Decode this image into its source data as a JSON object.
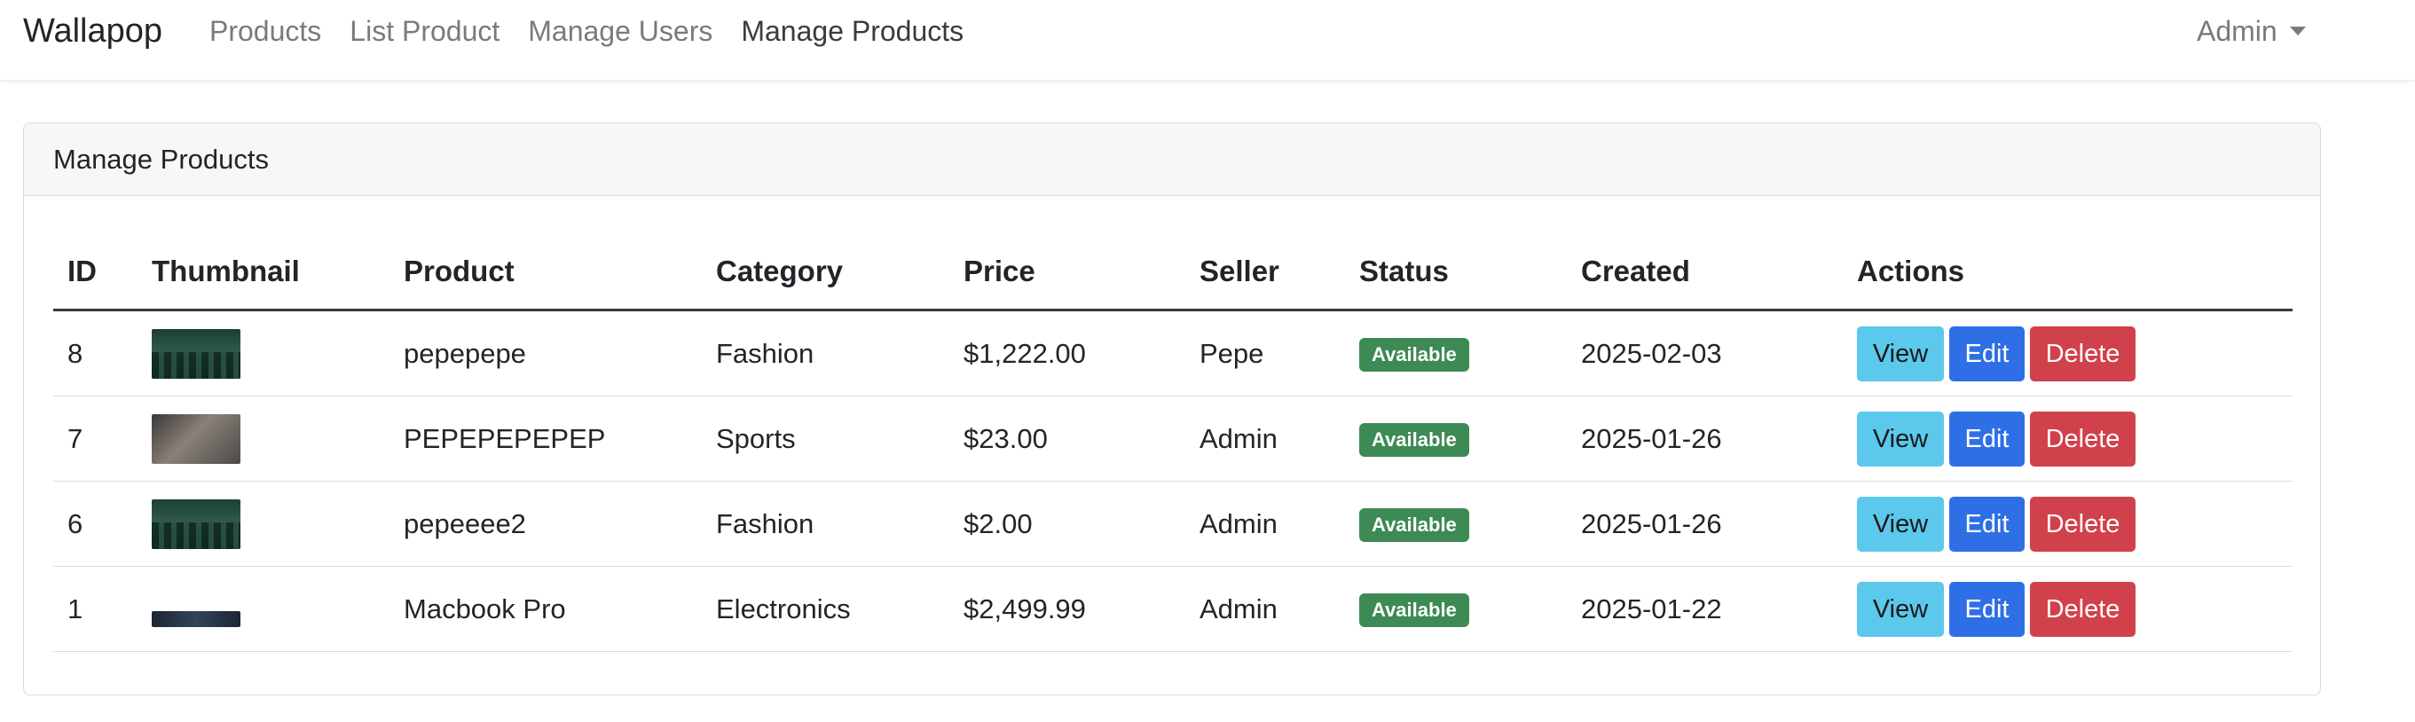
{
  "navbar": {
    "brand": "Wallapop",
    "links": [
      {
        "label": "Products",
        "active": false
      },
      {
        "label": "List Product",
        "active": false
      },
      {
        "label": "Manage Users",
        "active": false
      },
      {
        "label": "Manage Products",
        "active": true
      }
    ],
    "user_menu": "Admin"
  },
  "card": {
    "title": "Manage Products"
  },
  "table": {
    "headers": [
      "ID",
      "Thumbnail",
      "Product",
      "Category",
      "Price",
      "Seller",
      "Status",
      "Created",
      "Actions"
    ],
    "rows": [
      {
        "id": "8",
        "thumbnail": "forest-image",
        "product": "pepepepe",
        "category": "Fashion",
        "price": "$1,222.00",
        "seller": "Pepe",
        "status": "Available",
        "created": "2025-02-03"
      },
      {
        "id": "7",
        "thumbnail": "gym-image",
        "product": "PEPEPEPEPEP",
        "category": "Sports",
        "price": "$23.00",
        "seller": "Admin",
        "status": "Available",
        "created": "2025-01-26"
      },
      {
        "id": "6",
        "thumbnail": "forest-image",
        "product": "pepeeee2",
        "category": "Fashion",
        "price": "$2.00",
        "seller": "Admin",
        "status": "Available",
        "created": "2025-01-26"
      },
      {
        "id": "1",
        "thumbnail": "laptop-image",
        "product": "Macbook Pro",
        "category": "Electronics",
        "price": "$2,499.99",
        "seller": "Admin",
        "status": "Available",
        "created": "2025-01-22"
      }
    ],
    "actions": {
      "view": "View",
      "edit": "Edit",
      "delete": "Delete"
    }
  },
  "colors": {
    "status_available": "#3d8a54",
    "btn_view": "#5bc8ec",
    "btn_edit": "#2f6fe6",
    "btn_delete": "#d1414b"
  }
}
